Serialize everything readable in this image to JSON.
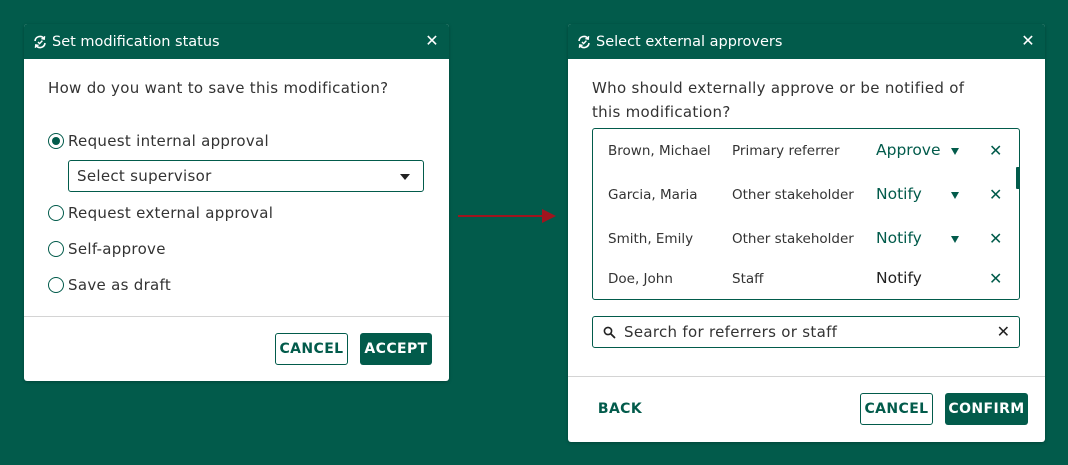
{
  "colors": {
    "brand": "#025b4b",
    "arrow": "#a0141e",
    "background": "#025b4b"
  },
  "dialog1": {
    "title": "Set modification status",
    "title_icon": "status-cycle-icon",
    "close_icon": "close-icon",
    "question": "How do you want to save this modification?",
    "options": [
      {
        "label": "Request internal approval",
        "selected": true
      },
      {
        "label": "Request external approval",
        "selected": false
      },
      {
        "label": "Self-approve",
        "selected": false
      },
      {
        "label": "Save as draft",
        "selected": false
      }
    ],
    "supervisor_select": "Select supervisor",
    "cancel_label": "CANCEL",
    "accept_label": "ACCEPT"
  },
  "dialog2": {
    "title": "Select external approvers",
    "title_icon": "status-cycle-icon",
    "close_icon": "close-icon",
    "question_line1": "Who should externally approve or be notified of",
    "question_line2": "this modification?",
    "approvers": [
      {
        "name": "Brown, Michael",
        "role": "Primary referrer",
        "action": "Approve",
        "has_dropdown": true
      },
      {
        "name": "Garcia, Maria",
        "role": "Other stakeholder",
        "action": "Notify",
        "has_dropdown": true
      },
      {
        "name": "Smith, Emily",
        "role": "Other stakeholder",
        "action": "Notify",
        "has_dropdown": true
      },
      {
        "name": "Doe, John",
        "role": "Staff",
        "action": "Notify",
        "has_dropdown": false
      }
    ],
    "search_placeholder": "Search for referrers or staff",
    "back_label": "BACK",
    "cancel_label": "CANCEL",
    "confirm_label": "CONFIRM"
  }
}
